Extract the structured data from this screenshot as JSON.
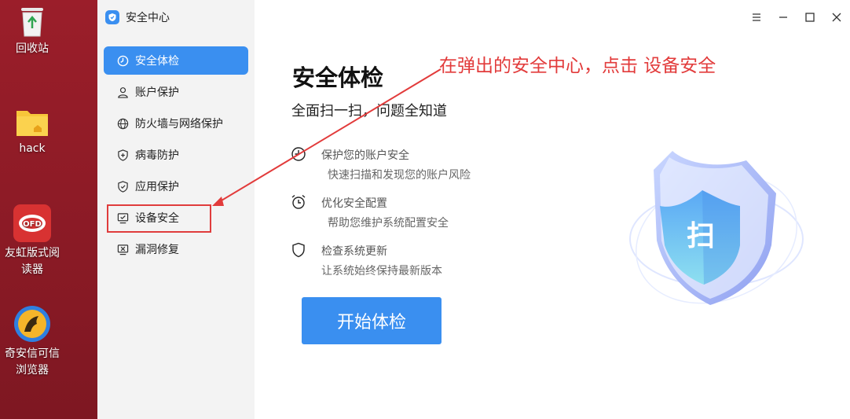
{
  "desktop": {
    "icons": [
      {
        "label": "回收站"
      },
      {
        "label": "hack"
      },
      {
        "label": "友虹版式阅读器"
      },
      {
        "label": "奇安信可信浏览器"
      }
    ]
  },
  "window": {
    "app_title": "安全中心",
    "sidebar": {
      "items": [
        {
          "label": "安全体检",
          "icon": "clock-scan-icon",
          "active": true
        },
        {
          "label": "账户保护",
          "icon": "user-icon"
        },
        {
          "label": "防火墙与网络保护",
          "icon": "globe-icon"
        },
        {
          "label": "病毒防护",
          "icon": "shield-plus-icon"
        },
        {
          "label": "应用保护",
          "icon": "shield-check-icon"
        },
        {
          "label": "设备安全",
          "icon": "monitor-check-icon"
        },
        {
          "label": "漏洞修复",
          "icon": "monitor-wrench-icon"
        }
      ]
    },
    "controls": {
      "menu": "menu-icon",
      "minimize": "minimize-icon",
      "maximize": "maximize-icon",
      "close": "close-icon"
    },
    "main": {
      "title": "安全体检",
      "subtitle": "全面扫一扫，问题全知道",
      "features": [
        {
          "title": "保护您的账户安全",
          "desc": "快速扫描和发现您的账户风险",
          "icon": "clock-icon"
        },
        {
          "title": "优化安全配置",
          "desc": "帮助您维护系统配置安全",
          "icon": "alarm-clock-icon"
        },
        {
          "title": "检查系统更新",
          "desc": "让系统始终保持最新版本",
          "icon": "shield-icon"
        }
      ],
      "start_button": "开始体检",
      "shield_char": "扫"
    }
  },
  "annotation": {
    "text": "在弹出的安全中心，点击 设备安全",
    "color": "#e23b3b"
  },
  "colors": {
    "accent": "#3a8ff0",
    "desktop_bg": "#8e1f28"
  }
}
